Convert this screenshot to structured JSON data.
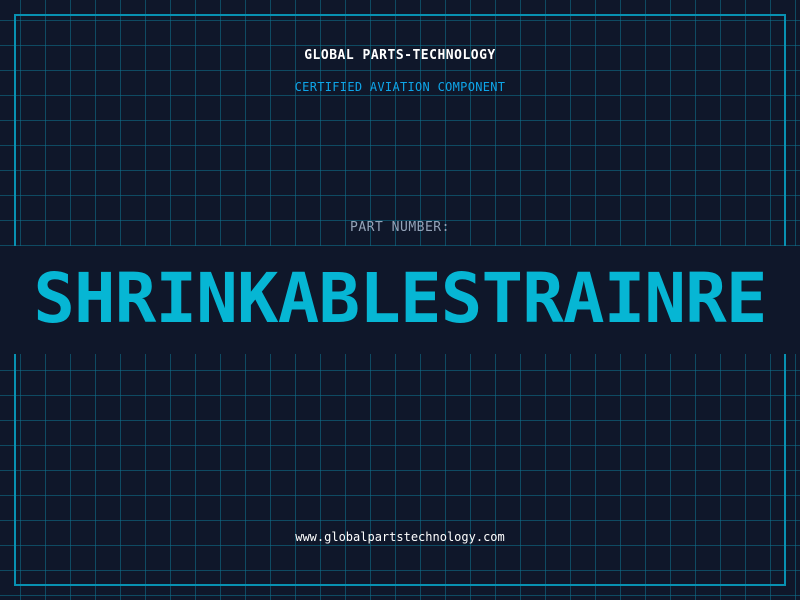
{
  "header": {
    "company": "GLOBAL PARTS-TECHNOLOGY",
    "tagline": "CERTIFIED AVIATION COMPONENT"
  },
  "part": {
    "label": "PART NUMBER:",
    "number": "SHRINKABLESTRAINRE"
  },
  "footer": {
    "website": "www.globalpartstechnology.com"
  },
  "colors": {
    "background": "#0f172a",
    "grid": "#0e7490",
    "frame": "#0891b2",
    "accent": "#06b6d4",
    "subtitle": "#0ea5e9",
    "label": "#94a3b8",
    "text": "#ffffff"
  }
}
